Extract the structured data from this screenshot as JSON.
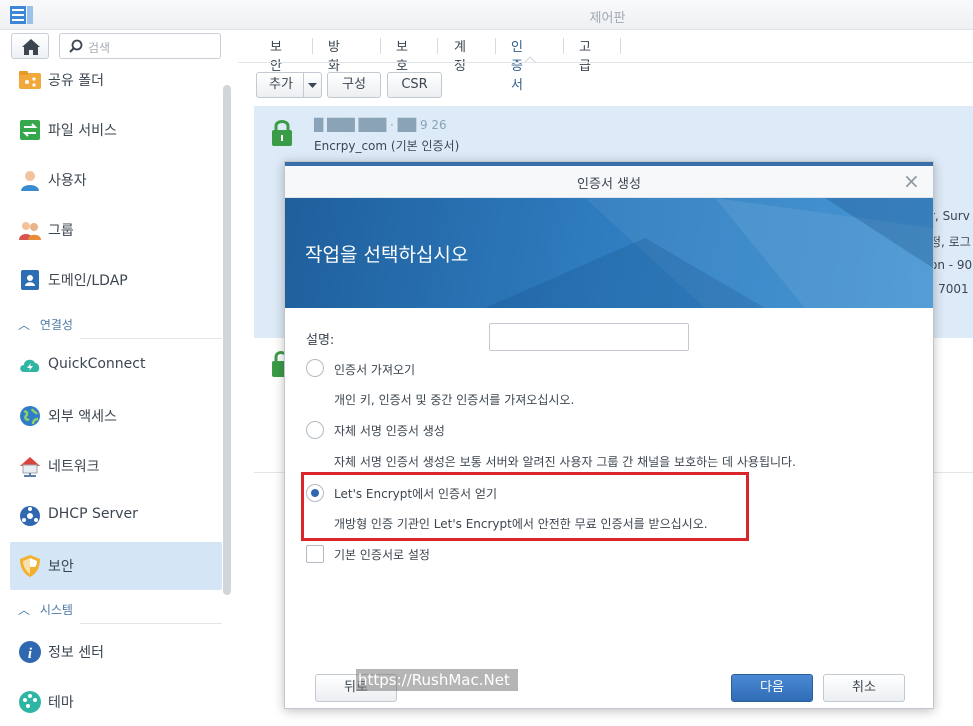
{
  "window": {
    "title": "제어판"
  },
  "sidebar": {
    "search_placeholder": "검색",
    "items": [
      {
        "label": "공유 폴더",
        "icon": "shared-folder-icon"
      },
      {
        "label": "파일 서비스",
        "icon": "file-services-icon"
      },
      {
        "label": "사용자",
        "icon": "user-icon"
      },
      {
        "label": "그룹",
        "icon": "group-icon"
      },
      {
        "label": "도메인/LDAP",
        "icon": "domain-ldap-icon"
      }
    ],
    "sections": [
      {
        "label": "연결성"
      },
      {
        "label": "시스템"
      }
    ],
    "items2": [
      {
        "label": "QuickConnect",
        "icon": "quickconnect-icon"
      },
      {
        "label": "외부 액세스",
        "icon": "external-access-icon"
      },
      {
        "label": "네트워크",
        "icon": "network-icon"
      },
      {
        "label": "DHCP Server",
        "icon": "dhcp-icon"
      },
      {
        "label": "보안",
        "icon": "security-shield-icon"
      }
    ],
    "items3": [
      {
        "label": "정보 센터",
        "icon": "info-center-icon"
      },
      {
        "label": "테마",
        "icon": "theme-icon"
      }
    ]
  },
  "tabs": [
    "보안",
    "방화벽",
    "보호",
    "계정",
    "인증서",
    "고급"
  ],
  "active_tab": "인증서",
  "toolbar": {
    "add": "추가",
    "configure": "구성",
    "csr": "CSR"
  },
  "cert_list": {
    "row1_title": "█ ███ ███ ·  ██ 9 26",
    "row1_sub": "Encrpy_com (기본 인증서)",
    "right_text": [
      "r, Surv",
      "정, 로그",
      "on - 90",
      "- 7001"
    ]
  },
  "modal": {
    "title": "인증서 생성",
    "heading": "작업을 선택하십시오",
    "desc_label": "설명:",
    "options": [
      {
        "label": "인증서 가져오기",
        "desc": "개인 키, 인증서 및 중간 인증서를 가져오십시오.",
        "selected": false
      },
      {
        "label": "자체 서명 인증서 생성",
        "desc": "자체 서명 인증서 생성은 보통 서버와 알려진 사용자 그룹 간 채널을 보호하는 데 사용됩니다.",
        "selected": false
      },
      {
        "label": "Let's Encrypt에서 인증서 얻기",
        "desc": "개방형 인증 기관인 Let's Encrypt에서 안전한 무료 인증서를 받으십시오.",
        "selected": true
      }
    ],
    "checkbox_label": "기본 인증서로 설정",
    "back": "뒤로",
    "next": "다음",
    "cancel": "취소"
  },
  "watermark": "https://RushMac.Net",
  "colors": {
    "accent": "#2f6cb5",
    "highlight": "#d8262a",
    "banner": "#2f7dc0"
  }
}
